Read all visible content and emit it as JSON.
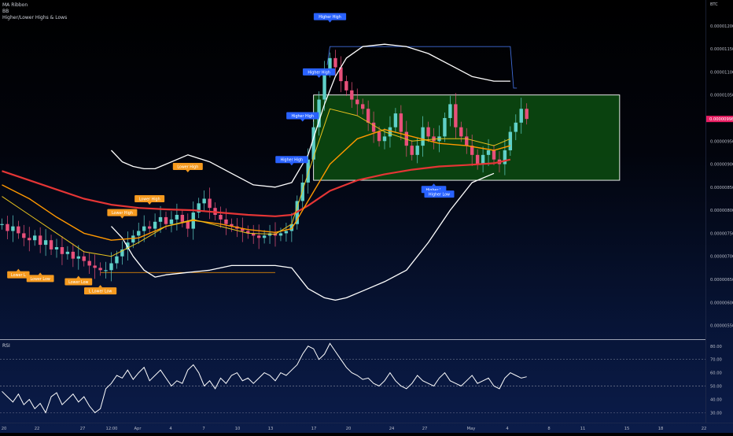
{
  "indicators": [
    "MA Ribbon",
    "BB",
    "Higher/Lower Highs & Lows"
  ],
  "symbol": "BTC",
  "rsi_title": "RSI",
  "current_price_label": "0.00000998",
  "colors": {
    "box_fill": "#0c4d10",
    "box_stroke": "#ffffff",
    "ma_red": "#e53535",
    "ma_orange": "#ff9800",
    "ma_yellow": "#e8c21e",
    "bb": "#ffffff",
    "candle_up": "#5fd0c8",
    "candle_down": "#e8507a",
    "higher_label": "#2962ff",
    "lower_label": "#f59a1f",
    "price_tag": "#e91e63"
  },
  "chart_data": [
    {
      "type": "line",
      "title": "",
      "symbol": "BTC",
      "y_ticks": [
        "0.00001200",
        "0.00001150",
        "0.00001100",
        "0.00001050",
        "0.00001000",
        "0.00000950",
        "0.00000900",
        "0.00000850",
        "0.00000800",
        "0.00000750",
        "0.00000700",
        "0.00000650",
        "0.00000600",
        "0.00000550"
      ],
      "y_tick_values": [
        12.0,
        11.5,
        11.0,
        10.5,
        10.0,
        9.5,
        9.0,
        8.5,
        8.0,
        7.5,
        7.0,
        6.5,
        6.0,
        5.5
      ],
      "ylim": [
        5.22,
        12.56
      ],
      "y_unit_note": "prices in units of 1e-6 BTC",
      "x_tick_labels": [
        "20",
        "22",
        "27",
        "12:00",
        "Apr",
        "4",
        "7",
        "10",
        "13",
        "17",
        "20",
        "24",
        "27",
        "May",
        "4",
        "8",
        "11",
        "15",
        "18",
        "22"
      ],
      "candles": [
        7.7,
        7.55,
        7.65,
        7.5,
        7.4,
        7.35,
        7.45,
        7.25,
        7.35,
        7.15,
        7.2,
        7.05,
        7.1,
        6.95,
        7.0,
        6.9,
        6.8,
        6.75,
        6.7,
        6.7,
        6.85,
        7.0,
        7.15,
        7.3,
        7.45,
        7.55,
        7.65,
        7.6,
        7.75,
        7.85,
        7.7,
        7.8,
        7.9,
        7.75,
        7.6,
        7.95,
        8.15,
        8.25,
        8.05,
        7.9,
        7.8,
        7.7,
        7.65,
        7.6,
        7.55,
        7.5,
        7.45,
        7.4,
        7.45,
        7.5,
        7.45,
        7.5,
        7.55,
        7.7,
        8.2,
        8.6,
        9.1,
        9.8,
        10.4,
        11.0,
        11.3,
        11.1,
        10.8,
        10.6,
        10.4,
        10.3,
        10.2,
        9.9,
        9.7,
        9.5,
        9.6,
        9.8,
        10.1,
        9.7,
        9.4,
        9.2,
        9.4,
        9.8,
        9.6,
        9.5,
        9.6,
        10.0,
        10.3,
        9.8,
        9.6,
        9.4,
        9.2,
        9.0,
        9.2,
        9.3,
        9.1,
        9.0,
        9.3,
        9.7,
        9.9,
        10.2,
        9.98
      ],
      "series": [
        {
          "name": "",
          "role": "bb-upper",
          "values": [
            [
              20,
              9.3
            ],
            [
              22,
              9.05
            ],
            [
              24,
              8.95
            ],
            [
              26,
              8.9
            ],
            [
              28,
              8.9
            ],
            [
              30,
              9.0
            ],
            [
              34,
              9.2
            ],
            [
              38,
              9.05
            ],
            [
              42,
              8.8
            ],
            [
              46,
              8.55
            ],
            [
              50,
              8.5
            ],
            [
              53,
              8.6
            ],
            [
              56,
              9.2
            ],
            [
              59,
              10.3
            ],
            [
              61,
              10.9
            ],
            [
              63,
              11.3
            ],
            [
              66,
              11.55
            ],
            [
              70,
              11.6
            ],
            [
              74,
              11.55
            ],
            [
              78,
              11.4
            ],
            [
              82,
              11.15
            ],
            [
              86,
              10.9
            ],
            [
              90,
              10.8
            ],
            [
              93,
              10.8
            ]
          ]
        },
        {
          "name": "",
          "role": "bb-lower",
          "values": [
            [
              20,
              7.65
            ],
            [
              22,
              7.4
            ],
            [
              24,
              7.0
            ],
            [
              26,
              6.7
            ],
            [
              28,
              6.55
            ],
            [
              30,
              6.6
            ],
            [
              34,
              6.65
            ],
            [
              38,
              6.7
            ],
            [
              42,
              6.8
            ],
            [
              46,
              6.8
            ],
            [
              50,
              6.8
            ],
            [
              53,
              6.75
            ],
            [
              56,
              6.3
            ],
            [
              59,
              6.1
            ],
            [
              61,
              6.05
            ],
            [
              63,
              6.1
            ],
            [
              66,
              6.25
            ],
            [
              70,
              6.45
            ],
            [
              74,
              6.7
            ],
            [
              78,
              7.3
            ],
            [
              82,
              8.0
            ],
            [
              86,
              8.6
            ],
            [
              90,
              8.8
            ]
          ]
        },
        {
          "name": "",
          "role": "ma-red",
          "values": [
            [
              0,
              8.85
            ],
            [
              5,
              8.65
            ],
            [
              10,
              8.45
            ],
            [
              15,
              8.25
            ],
            [
              20,
              8.12
            ],
            [
              25,
              8.05
            ],
            [
              30,
              8.02
            ],
            [
              35,
              8.0
            ],
            [
              40,
              7.95
            ],
            [
              45,
              7.9
            ],
            [
              50,
              7.87
            ],
            [
              53,
              7.9
            ],
            [
              56,
              8.1
            ],
            [
              60,
              8.42
            ],
            [
              65,
              8.65
            ],
            [
              70,
              8.78
            ],
            [
              75,
              8.88
            ],
            [
              80,
              8.95
            ],
            [
              85,
              8.98
            ],
            [
              90,
              9.02
            ],
            [
              93,
              9.1
            ]
          ]
        },
        {
          "name": "",
          "role": "ma-orange",
          "values": [
            [
              0,
              8.55
            ],
            [
              5,
              8.25
            ],
            [
              10,
              7.85
            ],
            [
              15,
              7.5
            ],
            [
              20,
              7.35
            ],
            [
              25,
              7.4
            ],
            [
              30,
              7.65
            ],
            [
              35,
              7.78
            ],
            [
              40,
              7.7
            ],
            [
              45,
              7.58
            ],
            [
              50,
              7.52
            ],
            [
              53,
              7.6
            ],
            [
              56,
              8.2
            ],
            [
              60,
              9.0
            ],
            [
              65,
              9.55
            ],
            [
              70,
              9.75
            ],
            [
              75,
              9.6
            ],
            [
              80,
              9.45
            ],
            [
              85,
              9.4
            ],
            [
              90,
              9.3
            ],
            [
              93,
              9.4
            ]
          ]
        },
        {
          "name": "",
          "role": "ma-yellow",
          "values": [
            [
              0,
              8.3
            ],
            [
              5,
              7.9
            ],
            [
              10,
              7.5
            ],
            [
              15,
              7.1
            ],
            [
              20,
              7.0
            ],
            [
              25,
              7.3
            ],
            [
              30,
              7.65
            ],
            [
              35,
              7.8
            ],
            [
              40,
              7.65
            ],
            [
              45,
              7.5
            ],
            [
              50,
              7.48
            ],
            [
              53,
              7.7
            ],
            [
              56,
              8.8
            ],
            [
              60,
              10.2
            ],
            [
              65,
              10.05
            ],
            [
              70,
              9.7
            ],
            [
              75,
              9.5
            ],
            [
              80,
              9.55
            ],
            [
              85,
              9.55
            ],
            [
              90,
              9.4
            ],
            [
              93,
              9.55
            ]
          ]
        }
      ],
      "resistance_line": {
        "y": 11.55,
        "from_x": 60,
        "to_x": 93
      },
      "support_line": {
        "y": 6.65,
        "from_x": 18,
        "to_x": 50
      },
      "range_box": {
        "y_top": 10.5,
        "y_bottom": 8.65,
        "from_x": 57,
        "to_x": 113
      },
      "annotations": [
        {
          "text": "Higher High",
          "x": 60,
          "y": 12.2,
          "kind": "higher"
        },
        {
          "text": "Higher High",
          "x": 58,
          "y": 11.0,
          "kind": "higher"
        },
        {
          "text": "Higher High",
          "x": 55,
          "y": 10.05,
          "kind": "higher"
        },
        {
          "text": "Higher High",
          "x": 53,
          "y": 9.1,
          "kind": "higher"
        },
        {
          "text": "Higher L",
          "x": 79,
          "y": 8.45,
          "kind": "higher",
          "below": true
        },
        {
          "text": "Higher Low",
          "x": 80,
          "y": 8.35,
          "kind": "higher",
          "below": true
        },
        {
          "text": "Lower High",
          "x": 34,
          "y": 8.95,
          "kind": "lower"
        },
        {
          "text": "Lower High",
          "x": 27,
          "y": 8.25,
          "kind": "lower"
        },
        {
          "text": "Lower High",
          "x": 22,
          "y": 7.95,
          "kind": "lower"
        },
        {
          "text": "Lower L",
          "x": 3,
          "y": 6.6,
          "kind": "lower",
          "below": true
        },
        {
          "text": "Lower Low",
          "x": 7,
          "y": 6.52,
          "kind": "lower",
          "below": true
        },
        {
          "text": "Lower Low",
          "x": 14,
          "y": 6.45,
          "kind": "lower",
          "below": true
        },
        {
          "text": "L Lower Low",
          "x": 18,
          "y": 6.25,
          "kind": "lower",
          "below": true
        }
      ],
      "last_price": 9.98
    },
    {
      "type": "line",
      "title": "RSI",
      "y_ticks": [
        "80.00",
        "70.00",
        "60.00",
        "50.00",
        "40.00",
        "30.00"
      ],
      "y_tick_values": [
        80,
        70,
        60,
        50,
        40,
        30
      ],
      "ylim": [
        25.5,
        84
      ],
      "reference_lines": [
        70,
        50,
        30
      ],
      "series": [
        {
          "name": "",
          "values": [
            46,
            42,
            38,
            44,
            36,
            40,
            33,
            37,
            30,
            42,
            45,
            36,
            40,
            44,
            38,
            42,
            35,
            30,
            33,
            48,
            52,
            58,
            56,
            62,
            55,
            60,
            64,
            54,
            58,
            62,
            56,
            50,
            54,
            52,
            62,
            66,
            60,
            50,
            54,
            48,
            56,
            52,
            58,
            60,
            54,
            56,
            52,
            56,
            60,
            58,
            54,
            60,
            58,
            62,
            66,
            74,
            80,
            78,
            70,
            74,
            82,
            76,
            70,
            64,
            60,
            58,
            55,
            56,
            52,
            50,
            54,
            60,
            54,
            50,
            48,
            52,
            58,
            54,
            52,
            50,
            56,
            60,
            54,
            52,
            50,
            54,
            58,
            52,
            54,
            56,
            50,
            48,
            56,
            60,
            58,
            56,
            57
          ]
        }
      ]
    }
  ]
}
